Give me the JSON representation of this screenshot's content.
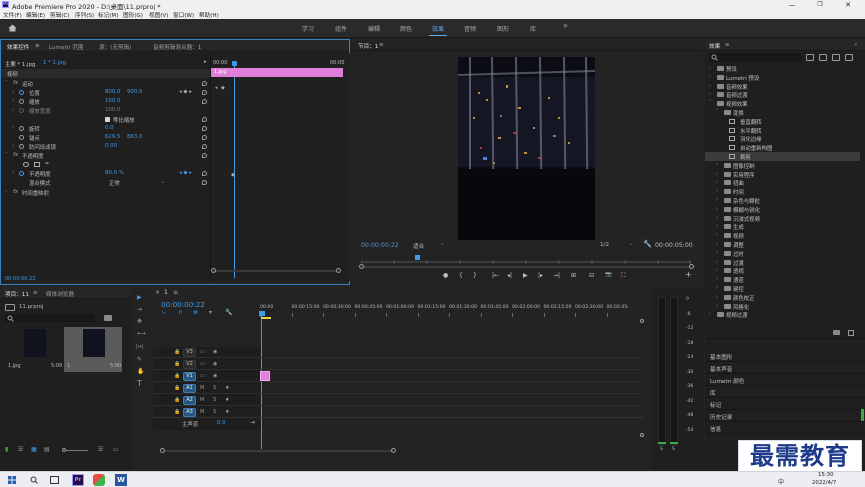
{
  "app": {
    "logo": "Pr",
    "title": "Adobe Premiere Pro 2020 - D:\\桌面\\11.prproj *",
    "window_controls": [
      "—",
      "❐",
      "✕"
    ]
  },
  "menu": [
    "文件(F)",
    "编辑(E)",
    "剪辑(C)",
    "序列(S)",
    "标记(M)",
    "图形(G)",
    "视图(V)",
    "窗口(W)",
    "帮助(H)"
  ],
  "workspaces": {
    "home_icon": "home-icon",
    "items": [
      "学习",
      "组件",
      "编辑",
      "颜色",
      "效果",
      "音频",
      "图形",
      "库"
    ],
    "active": "效果",
    "more": "»"
  },
  "effect_controls": {
    "tabs": [
      "效果控件",
      "Lumetri 范围",
      "源：(无剪辑)",
      "音频剪辑混合器：1"
    ],
    "tab_menu": "≡",
    "header_left": "主要 * 1.jpg",
    "header_right": "1 * 1.jpg",
    "ruler": {
      "start": "00:00",
      "end": "00:00"
    },
    "clip_label": "1.jpg",
    "section_video": "视频",
    "motion": "运动",
    "position": {
      "label": "位置",
      "x": "800.0",
      "y": "900.0"
    },
    "scale": {
      "label": "缩放",
      "value": "100.0"
    },
    "scale_width": {
      "label": "缩放宽度",
      "value": "100.0"
    },
    "uniform": {
      "label": "等比缩放",
      "checked": true
    },
    "rotation": {
      "label": "旋转",
      "value": "0.0"
    },
    "anchor": {
      "label": "锚点",
      "x": "629.5",
      "y": "863.0"
    },
    "antiflicker": {
      "label": "防闪烁滤镜",
      "value": "0.00"
    },
    "opacity_group": "不透明度",
    "opacity": {
      "label": "不透明度",
      "value": "80.0 %"
    },
    "blend": {
      "label": "混合模式",
      "value": "正常"
    },
    "time_remap": "时间重映射",
    "timecode": "00:00:00:22"
  },
  "program": {
    "title": "节目：1",
    "menu": "≡",
    "timecode": "00:00:00:22",
    "fit": "适合",
    "resolution": "1/2",
    "duration": "00:00:05:00",
    "controls": [
      "●",
      "{",
      "}",
      "|←",
      "◂|",
      "▶",
      "|▸",
      "→|",
      "⊞",
      "⊟",
      "📷",
      "⛶"
    ],
    "add": "+"
  },
  "effects": {
    "title": "效果",
    "menu": "≡",
    "search_icon": "search-icon",
    "items": [
      {
        "label": "预设",
        "level": 0,
        "open": false
      },
      {
        "label": "Lumetri 预设",
        "level": 0,
        "open": false
      },
      {
        "label": "音频效果",
        "level": 0,
        "open": false
      },
      {
        "label": "音频过渡",
        "level": 0,
        "open": false
      },
      {
        "label": "视频效果",
        "level": 0,
        "open": true
      },
      {
        "label": "变换",
        "level": 1,
        "open": true
      },
      {
        "label": "垂直翻转",
        "level": 2,
        "open": false
      },
      {
        "label": "水平翻转",
        "level": 2,
        "open": false
      },
      {
        "label": "羽化边缘",
        "level": 2,
        "open": false
      },
      {
        "label": "自动重新构图",
        "level": 2,
        "open": false
      },
      {
        "label": "裁剪",
        "level": 2,
        "open": false,
        "selected": true
      },
      {
        "label": "图像控制",
        "level": 1,
        "open": false
      },
      {
        "label": "实用程序",
        "level": 1,
        "open": false
      },
      {
        "label": "扭曲",
        "level": 1,
        "open": false
      },
      {
        "label": "时间",
        "level": 1,
        "open": false
      },
      {
        "label": "杂色与颗粒",
        "level": 1,
        "open": false
      },
      {
        "label": "模糊与锐化",
        "level": 1,
        "open": false
      },
      {
        "label": "沉浸式视频",
        "level": 1,
        "open": false
      },
      {
        "label": "生成",
        "level": 1,
        "open": false
      },
      {
        "label": "视频",
        "level": 1,
        "open": false
      },
      {
        "label": "调整",
        "level": 1,
        "open": false
      },
      {
        "label": "过时",
        "level": 1,
        "open": false
      },
      {
        "label": "过渡",
        "level": 1,
        "open": false
      },
      {
        "label": "透视",
        "level": 1,
        "open": false
      },
      {
        "label": "通道",
        "level": 1,
        "open": false
      },
      {
        "label": "键控",
        "level": 1,
        "open": false
      },
      {
        "label": "颜色校正",
        "level": 1,
        "open": false
      },
      {
        "label": "风格化",
        "level": 1,
        "open": false
      },
      {
        "label": "视频过渡",
        "level": 0,
        "open": false
      }
    ],
    "side_panels": [
      "基本图形",
      "基本声音",
      "Lumetri 颜色",
      "库",
      "标记",
      "历史记录",
      "信息"
    ]
  },
  "project": {
    "tabs": [
      "项目：11",
      "媒体浏览器"
    ],
    "file": "11.prproj",
    "items": [
      {
        "name": "1.jpg",
        "duration": "5:00"
      },
      {
        "name": "1",
        "duration": "5:00"
      }
    ]
  },
  "tools": [
    "▶",
    "⇥",
    "✥",
    "⟷",
    "|↔|",
    "✎",
    "✋",
    "T"
  ],
  "timeline": {
    "tab": "1",
    "menu": "≡",
    "close": "×",
    "timecode": "00:00:00:22",
    "ruler": [
      "00:00",
      "00:00:15:00",
      "00:00:30:00",
      "00:00:45:00",
      "00:01:00:00",
      "00:01:15:00",
      "00:01:30:00",
      "00:01:45:00",
      "00:02:00:00",
      "00:02:15:00",
      "00:02:30:00",
      "00:02:45:"
    ],
    "tracks": [
      "V3",
      "V2",
      "V1",
      "A1",
      "A2",
      "A3"
    ],
    "master": {
      "label": "主声道",
      "value": "0.0"
    }
  },
  "audio_meter": {
    "scale": [
      "0",
      "-6",
      "-12",
      "-18",
      "-24",
      "-30",
      "-36",
      "-42",
      "-48",
      "-54"
    ],
    "bottom": [
      "S",
      "S"
    ]
  },
  "watermark": {
    "text": "最需教育"
  },
  "taskbar": {
    "time": "15:30",
    "date": "2022/4/7",
    "ime": "中",
    "apps": [
      "Pr",
      "W"
    ]
  },
  "colors": {
    "accent": "#3f9ae8",
    "clip": "#e07fd9",
    "track_on": "#255783",
    "watermark": "#1e3a8a"
  }
}
